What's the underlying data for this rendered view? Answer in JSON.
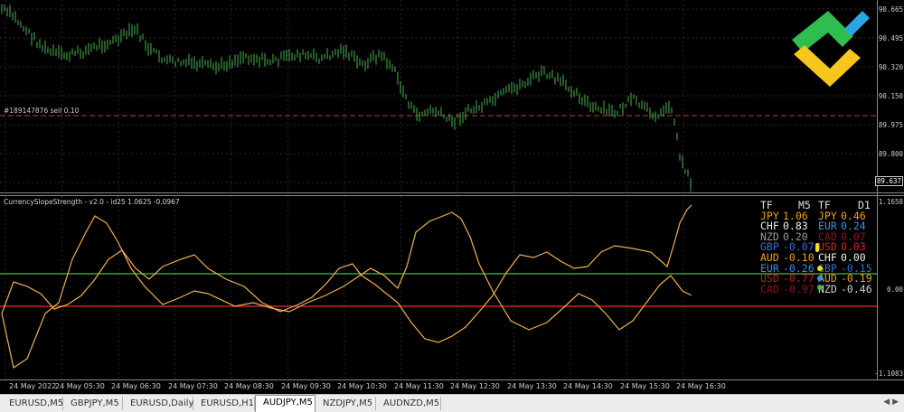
{
  "main_chart": {
    "symbol": "AUDJPY",
    "timeframe": "M5",
    "order_label": "#189147876 sell 0.10",
    "price_ticks": [
      "90.665",
      "90.495",
      "90.320",
      "90.150",
      "89.975",
      "89.800",
      "89.637"
    ],
    "current_price": "89.637",
    "candle_color": "#4caf50"
  },
  "indicator": {
    "title": "CurrencySlopeStrength - v2.0 - id25 1.0625 -0.0967",
    "scale_ticks": [
      "1.1658",
      "0.00",
      "-1.1083"
    ],
    "levels": {
      "upper_color": "#3fbf3f",
      "lower_color": "#e03030"
    },
    "line_color": "#f0b050",
    "panel": {
      "headers": [
        {
          "text": "TF",
          "color": "#e0e0e0"
        },
        {
          "text": "M5",
          "color": "#e0e0e0"
        },
        {
          "text": "TF",
          "color": "#e0e0e0"
        },
        {
          "text": "D1",
          "color": "#e0e0e0"
        }
      ],
      "rows": [
        {
          "l_name": "JPY",
          "l_val": "1.06",
          "l_color": "#f0a020",
          "r_name": "JPY",
          "r_val": "0.46",
          "r_color": "#f0a020"
        },
        {
          "l_name": "CHF",
          "l_val": "0.83",
          "l_color": "#f0f0f0",
          "r_name": "EUR",
          "r_val": "0.24",
          "r_color": "#3a8ee6"
        },
        {
          "l_name": "NZD",
          "l_val": "0.20",
          "l_color": "#9a9a9a",
          "r_name": "CAD",
          "r_val": "0.07",
          "r_color": "#8b1a1a"
        },
        {
          "l_name": "GBP",
          "l_val": "-0.07",
          "l_color": "#3a6bd6",
          "r_name": "USD",
          "r_val": "0.03",
          "r_color": "#e02020"
        },
        {
          "l_name": "AUD",
          "l_val": "-0.10",
          "l_color": "#f0a020",
          "r_name": "CHF",
          "r_val": "0.00",
          "r_color": "#f0f0f0"
        },
        {
          "l_name": "EUR",
          "l_val": "-0.26",
          "l_color": "#3a8ee6",
          "r_name": "GBP",
          "r_val": "-0.15",
          "r_color": "#3a6bd6"
        },
        {
          "l_name": "USD",
          "l_val": "-0.77",
          "l_color": "#c02020",
          "r_name": "AUD",
          "r_val": "-0.19",
          "r_color": "#f0a020"
        },
        {
          "l_name": "CAD",
          "l_val": "-0.97",
          "l_color": "#8b1a1a",
          "r_name": "NZD",
          "r_val": "-0.46",
          "r_color": "#d0d0d0"
        }
      ]
    }
  },
  "time_ticks": [
    "24 May 2022",
    "24 May 05:30",
    "24 May 06:30",
    "24 May 07:30",
    "24 May 08:30",
    "24 May 09:30",
    "24 May 10:30",
    "24 May 11:30",
    "24 May 12:30",
    "24 May 13:30",
    "24 May 14:30",
    "24 May 15:30",
    "24 May 16:30"
  ],
  "tabs": [
    "EURUSD,M5",
    "GBPJPY,M5",
    "EURUSD,Daily",
    "EURUSD,H1",
    "AUDJPY,M5",
    "NZDJPY,M5",
    "AUDNZD,M5"
  ],
  "active_tab": "AUDJPY,M5",
  "logo": {
    "colors": [
      "#2ebd4e",
      "#f7c61a",
      "#2aa7e0"
    ]
  }
}
